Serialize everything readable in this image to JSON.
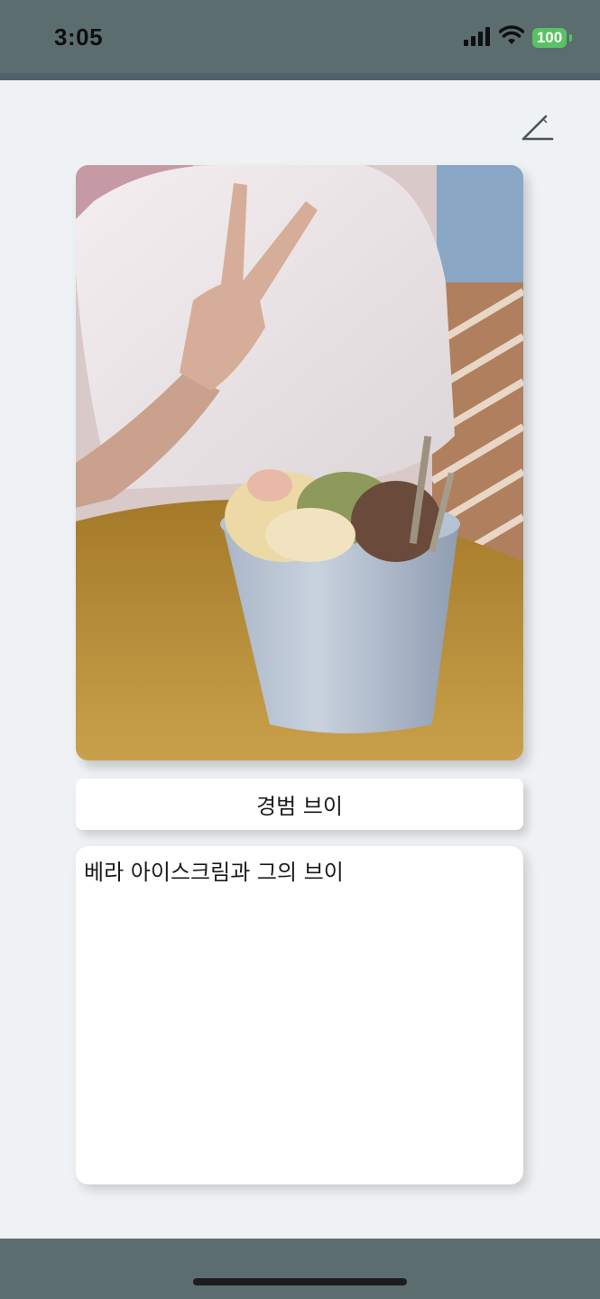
{
  "status_bar": {
    "time": "3:05",
    "battery": "100",
    "icons": [
      "signal-icon",
      "wifi-icon",
      "battery-icon"
    ],
    "battery_color": "#59c262"
  },
  "toolbar": {
    "edit_icon": "pencil-icon"
  },
  "post": {
    "photo_alt": "Person making a V sign behind a cup of ice cream",
    "title": "경범 브이",
    "memo": "베라 아이스크림과 그의 브이"
  },
  "colors": {
    "bars": "#5c6d70",
    "background": "#eff2f4",
    "card": "#ffffff"
  }
}
